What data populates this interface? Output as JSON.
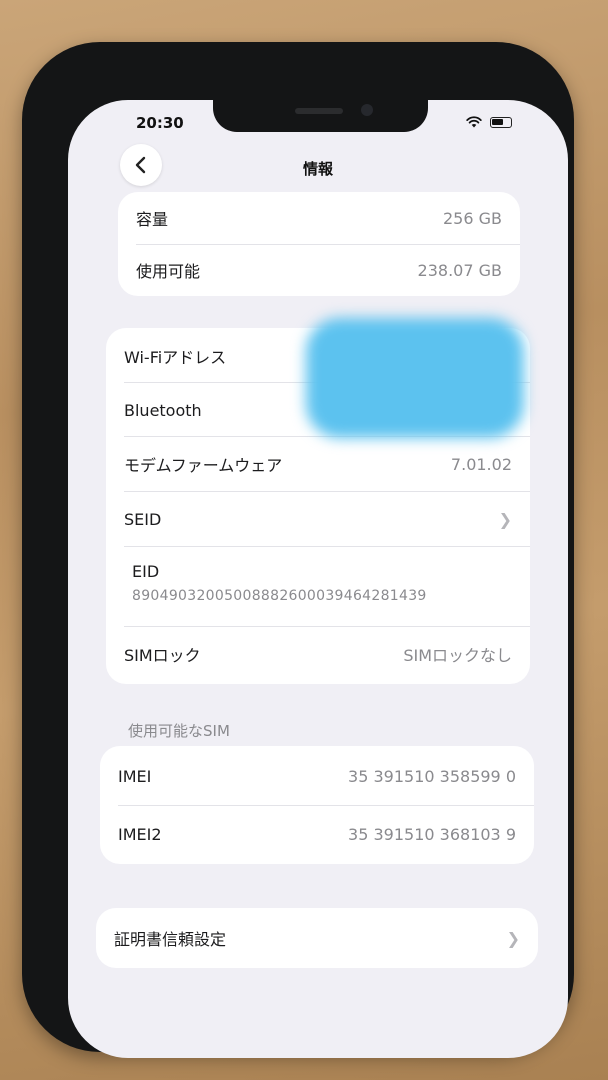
{
  "status_bar": {
    "time": "20:30"
  },
  "nav": {
    "title": "情報",
    "back_icon": "chevron-left-icon"
  },
  "storage": {
    "capacity_label": "容量",
    "capacity_value": "256 GB",
    "available_label": "使用可能",
    "available_value": "238.07 GB"
  },
  "network": {
    "wifi_label": "Wi-Fiアドレス",
    "bluetooth_label": "Bluetooth",
    "modem_label": "モデムファームウェア",
    "modem_value": "7.01.02",
    "seid_label": "SEID",
    "eid_label": "EID",
    "eid_value": "89049032005008882600039464281439",
    "simlock_label": "SIMロック",
    "simlock_value": "SIMロックなし"
  },
  "sim_section": {
    "header": "使用可能なSIM",
    "imei_label": "IMEI",
    "imei_value": "35 391510 358599 0",
    "imei2_label": "IMEI2",
    "imei2_value": "35 391510 368103 9"
  },
  "certificate": {
    "label": "証明書信頼設定"
  },
  "colors": {
    "redaction": "#5cc2ef",
    "screen_bg": "#f0eff5",
    "card_bg": "#ffffff"
  }
}
